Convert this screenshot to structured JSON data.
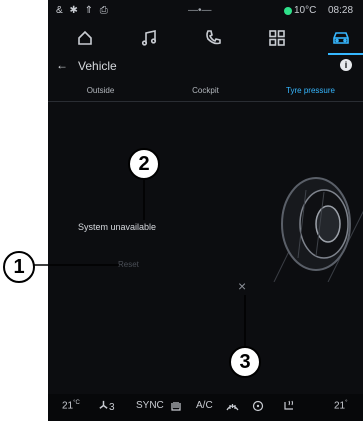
{
  "statusbar": {
    "left_icons": "& ✱ ⇑ ⎙",
    "mid": "—•—",
    "temperature": "10°C",
    "time": "08:28",
    "dot_color": "#2fe08a"
  },
  "nav": {
    "items": [
      {
        "icon": "home-icon"
      },
      {
        "icon": "music-icon"
      },
      {
        "icon": "phone-icon"
      },
      {
        "icon": "apps-grid-icon"
      },
      {
        "icon": "car-icon",
        "active": true
      }
    ],
    "accent": "#36b7ff"
  },
  "header": {
    "back": "←",
    "title": "Vehicle",
    "info": "i"
  },
  "tabs": [
    {
      "label": "Outside",
      "active": false
    },
    {
      "label": "Cockpit",
      "active": false
    },
    {
      "label": "Tyre pressure",
      "active": true
    }
  ],
  "main": {
    "status": "System unavailable",
    "reset_label": "Reset",
    "close_label": "×"
  },
  "climate": {
    "left_temp": "21",
    "left_unit": "°C",
    "fan": "3",
    "sync": "SYNC",
    "ac": "A/C",
    "right_temp": "21",
    "right_unit": "°"
  },
  "callouts": [
    {
      "label": "1"
    },
    {
      "label": "2"
    },
    {
      "label": "3"
    }
  ]
}
